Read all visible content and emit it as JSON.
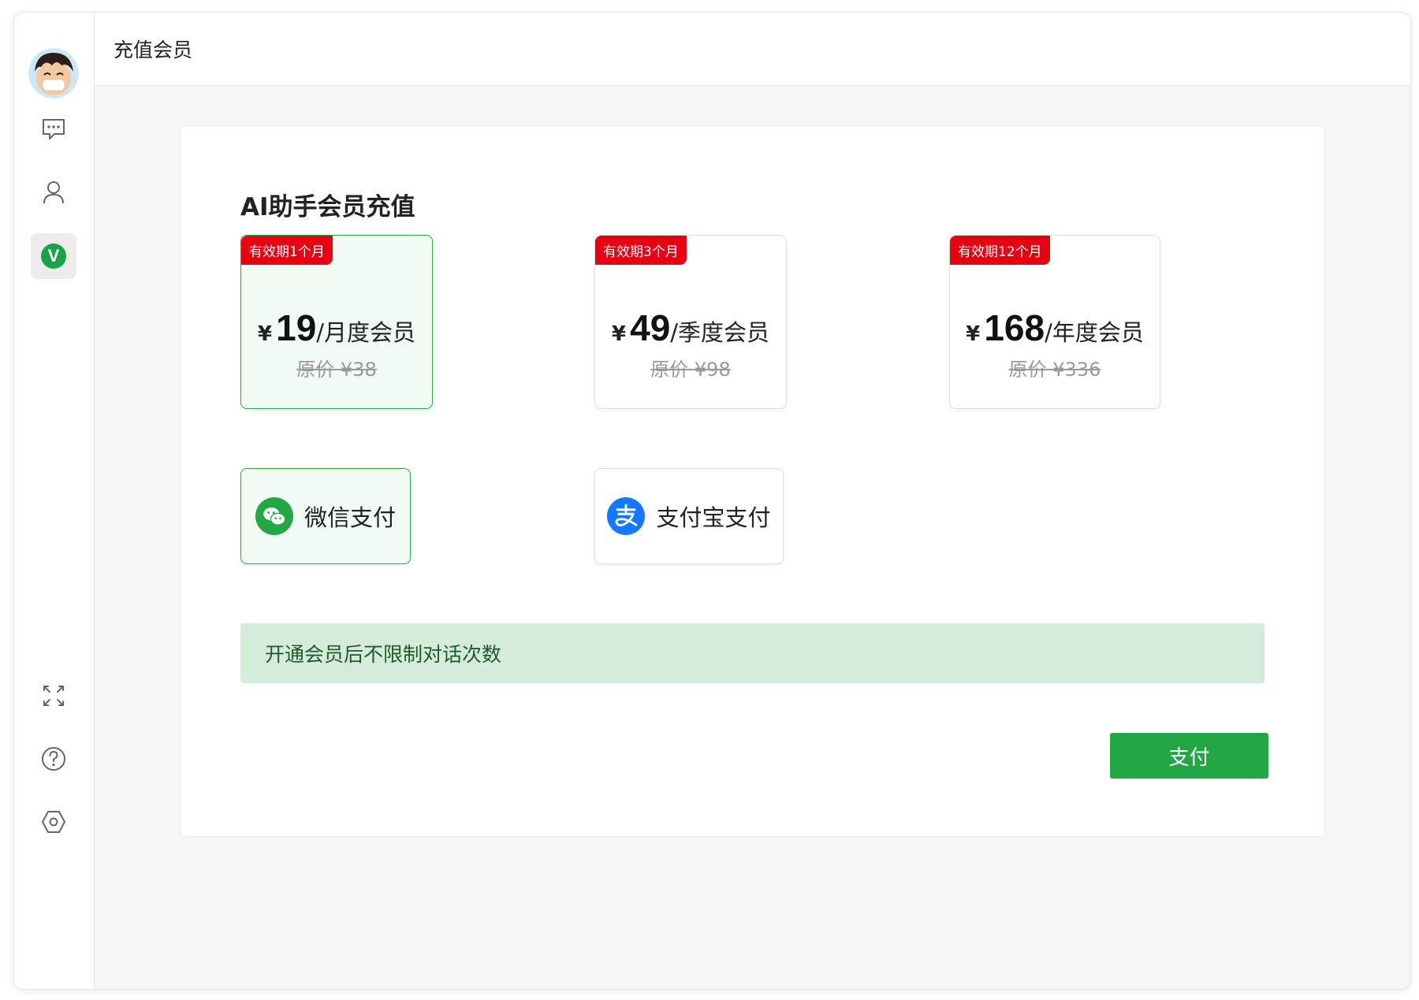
{
  "header": {
    "title": "充值会员"
  },
  "sidebar": {
    "items": [
      {
        "name": "chat",
        "icon": "chat-icon"
      },
      {
        "name": "user",
        "icon": "user-icon"
      },
      {
        "name": "vip",
        "icon": "vip-icon",
        "label": "V",
        "active": true
      }
    ],
    "bottom_items": [
      {
        "name": "fullscreen",
        "icon": "fullscreen-icon"
      },
      {
        "name": "help",
        "icon": "help-icon"
      },
      {
        "name": "settings",
        "icon": "settings-icon"
      }
    ]
  },
  "card": {
    "title": "AI助手会员充值"
  },
  "plans": [
    {
      "tag": "有效期1个月",
      "currency": "¥",
      "price": "19",
      "period": "/月度会员",
      "original": "原价 ¥38",
      "selected": true
    },
    {
      "tag": "有效期3个月",
      "currency": "¥",
      "price": "49",
      "period": "/季度会员",
      "original": "原价 ¥98",
      "selected": false
    },
    {
      "tag": "有效期12个月",
      "currency": "¥",
      "price": "168",
      "period": "/年度会员",
      "original": "原价 ¥336",
      "selected": false
    }
  ],
  "payment_methods": [
    {
      "label": "微信支付",
      "icon": "wechat-pay-icon",
      "selected": true
    },
    {
      "label": "支付宝支付",
      "icon": "alipay-icon",
      "selected": false
    }
  ],
  "notice": "开通会员后不限制对话次数",
  "pay_button": "支付",
  "colors": {
    "accent_green": "#22a745",
    "tag_red": "#e60012",
    "alipay_blue": "#1677ff",
    "notice_bg": "#d4ecd9"
  }
}
